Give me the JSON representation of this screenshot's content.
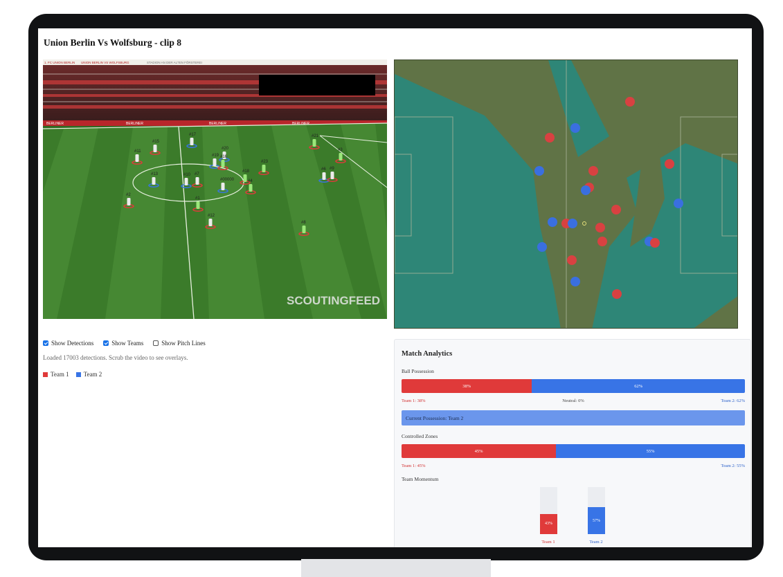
{
  "page": {
    "title": "Union Berlin Vs Wolfsburg - clip 8"
  },
  "video": {
    "banner_texts": [
      "1. FC UNION BERLIN",
      "UNION BERLIN VS WOLFSBURG",
      "STADION AN DER ALTEN FÖRSTEREI"
    ],
    "watermark": "SCOUTINGFEED",
    "ad_board_text": "BERLINER",
    "player_labels": [
      "#15",
      "#17",
      "#11",
      "#20",
      "#19",
      "#16",
      "#23",
      "#13",
      "#10",
      "#7",
      "#18",
      "#4",
      "#21",
      "#3",
      "#6",
      "#9",
      "#2",
      "#1",
      "#12",
      "#8",
      "#00000"
    ]
  },
  "controls": {
    "show_detections": {
      "label": "Show Detections",
      "checked": true
    },
    "show_teams": {
      "label": "Show Teams",
      "checked": true
    },
    "show_pitch_lines": {
      "label": "Show Pitch Lines",
      "checked": false
    }
  },
  "status_text": "Loaded 17003 detections. Scrub the video to see overlays.",
  "legend": {
    "team1": "Team 1",
    "team2": "Team 2"
  },
  "colors": {
    "team1": "#e03a3a",
    "team2": "#3874e6",
    "zone_team1": "#607346",
    "zone_team2": "#2e8677"
  },
  "analytics": {
    "title": "Match Analytics",
    "possession": {
      "label": "Ball Possession",
      "team1_value": "38%",
      "team2_value": "62%",
      "team1_pct": 38,
      "team2_pct": 62,
      "team1_text": "Team 1: 38%",
      "neutral_text": "Neutral: 0%",
      "team2_text": "Team 2: 62%"
    },
    "current_possession": "Current Possession: Team 2",
    "zones": {
      "label": "Controlled Zones",
      "team1_value": "45%",
      "team2_value": "55%",
      "team1_pct": 45,
      "team2_pct": 55,
      "team1_text": "Team 1: 45%",
      "team2_text": "Team 2: 55%"
    },
    "momentum": {
      "label": "Team Momentum",
      "team1_value": "43%",
      "team2_value": "57%",
      "team1_fraction": 0.43,
      "team2_fraction": 0.57,
      "team1_label": "Team 1",
      "team2_label": "Team 2"
    }
  }
}
